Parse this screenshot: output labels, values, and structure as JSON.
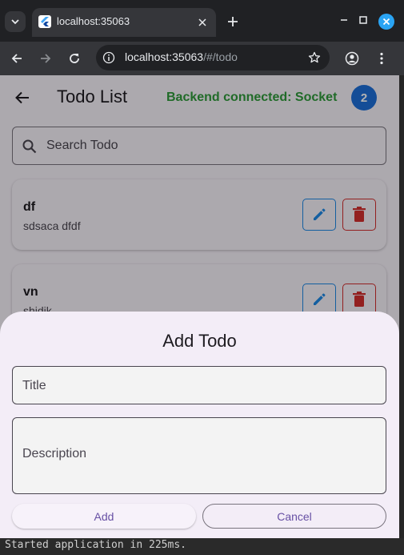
{
  "browser": {
    "tab_title": "localhost:35063",
    "url_host": "localhost:35063",
    "url_path": "/#/todo",
    "accent": "#2aa4f4"
  },
  "app": {
    "title": "Todo List",
    "backend_status": "Backend connected: Socket",
    "todo_count": "2",
    "status_color": "#2e9a3a",
    "badge_color": "#1e6fd9"
  },
  "search": {
    "placeholder": "Search Todo",
    "value": ""
  },
  "todos": [
    {
      "title": "df",
      "description": "sdsaca dfdf"
    },
    {
      "title": "vn",
      "description": "shidik"
    }
  ],
  "dialog": {
    "title": "Add Todo",
    "title_field": {
      "placeholder": "Title",
      "value": ""
    },
    "description_field": {
      "placeholder": "Description",
      "value": ""
    },
    "add_label": "Add",
    "cancel_label": "Cancel"
  },
  "terminal": {
    "text": "Started application in 225ms."
  },
  "icons": {
    "tab_list": "chevron-down-icon",
    "favicon": "flutter-icon",
    "back": "arrow-left-icon",
    "forward": "arrow-right-icon",
    "reload": "reload-icon",
    "info": "info-icon",
    "star": "star-icon",
    "profile": "account-icon",
    "menu": "more-vert-icon",
    "search": "search-icon",
    "edit": "pencil-icon",
    "delete": "trash-icon"
  }
}
